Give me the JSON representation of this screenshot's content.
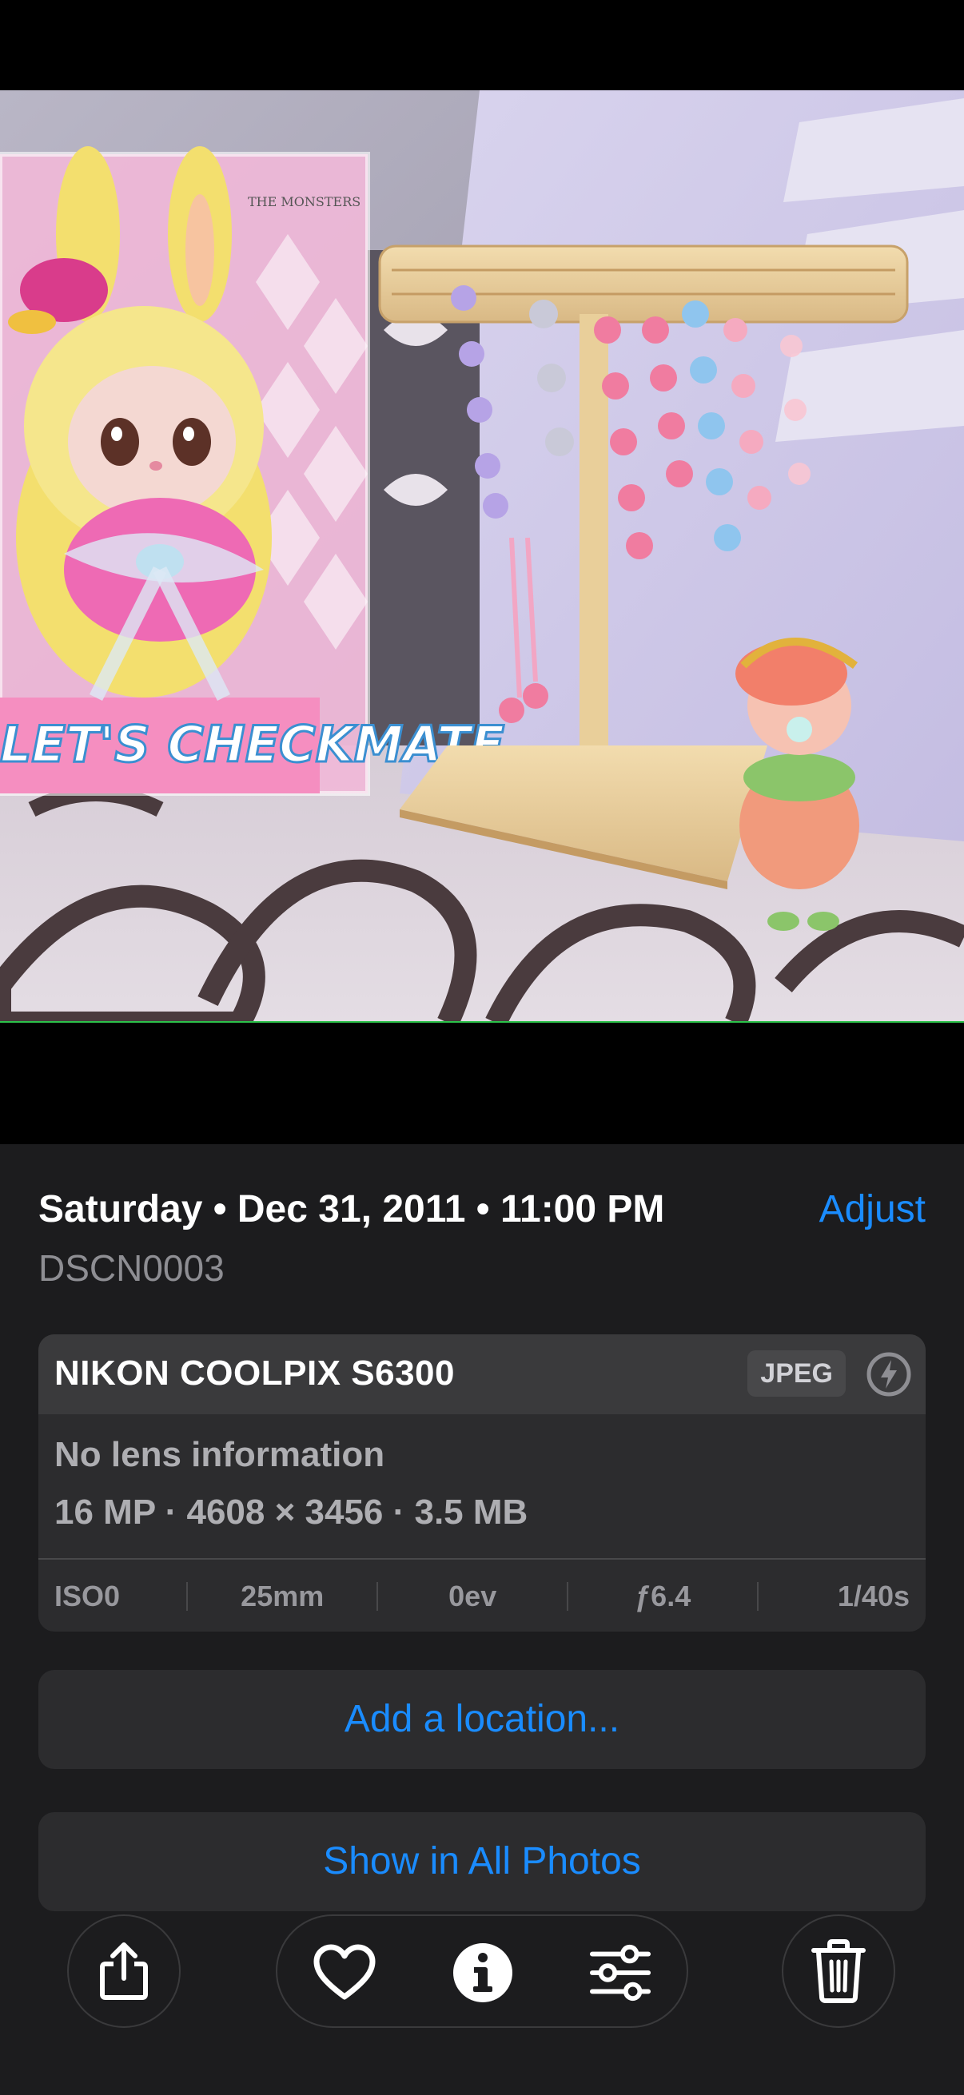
{
  "photo": {
    "box_text_top": "THE MONSTERS",
    "box_text_main": "LET'S CHECKMATE"
  },
  "info": {
    "date": "Saturday • Dec 31, 2011 • 11:00 PM",
    "adjust_label": "Adjust",
    "filename": "DSCN0003"
  },
  "camera": {
    "name": "NIKON COOLPIX S6300",
    "format": "JPEG",
    "lens": "No lens information",
    "specs": "16 MP · 4608 × 3456 · 3.5 MB",
    "exif": {
      "iso": "ISO0",
      "focal": "25mm",
      "ev": "0ev",
      "aperture": "ƒ6.4",
      "shutter": "1/40s"
    }
  },
  "actions": {
    "add_location": "Add a location...",
    "show_all": "Show in All Photos"
  },
  "toolbar": {
    "share_icon": "share-icon",
    "favorite_icon": "heart-icon",
    "info_icon": "info-icon",
    "adjust_icon": "sliders-icon",
    "delete_icon": "trash-icon"
  },
  "colors": {
    "accent": "#1a8cff",
    "panel": "#1c1c1e",
    "card": "#2c2c2e"
  }
}
